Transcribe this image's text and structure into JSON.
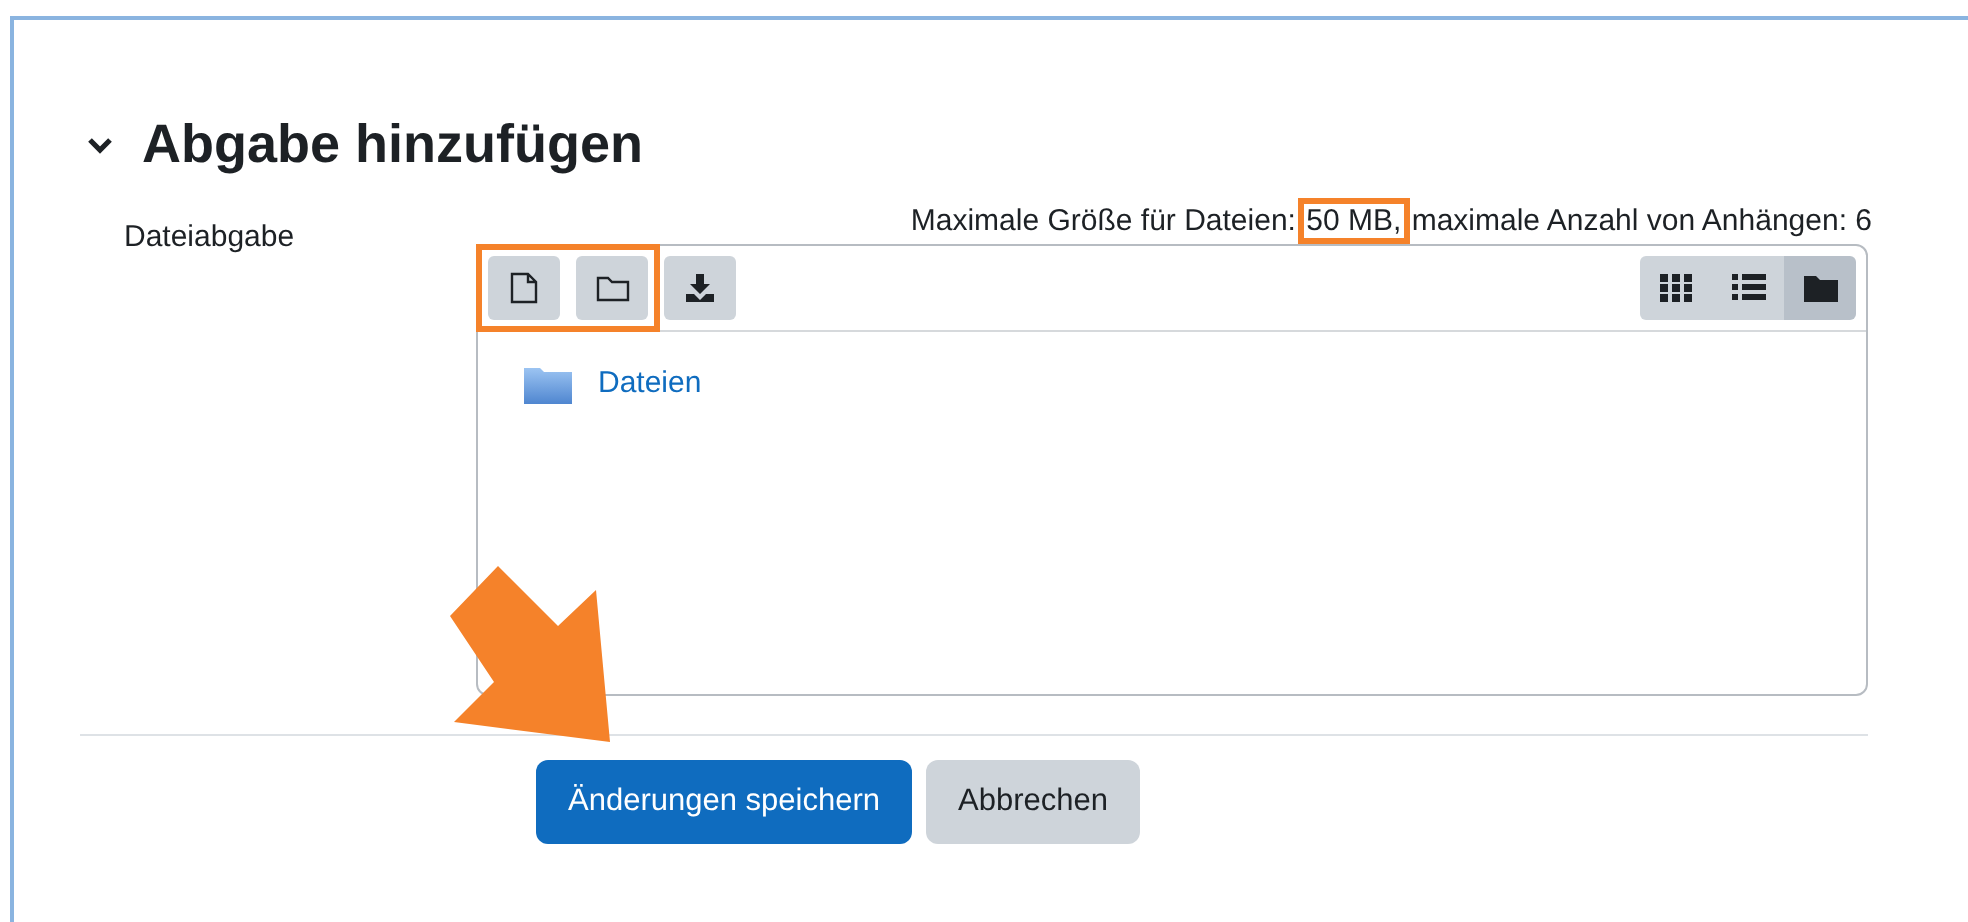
{
  "section": {
    "title": "Abgabe hinzufügen",
    "expanded": true
  },
  "field": {
    "label": "Dateiabgabe",
    "limits": {
      "before": "Maximale Größe für Dateien: ",
      "highlight": "50 MB,",
      "after": " maximale Anzahl von Anhängen: 6"
    }
  },
  "toolbar_groups": [
    {
      "highlighted": true,
      "buttons": [
        {
          "kind": "file"
        },
        {
          "kind": "folder"
        }
      ]
    },
    {
      "buttons": [
        {
          "kind": "download"
        }
      ]
    }
  ],
  "views": [
    {
      "kind": "icons",
      "selected": false
    },
    {
      "kind": "list",
      "selected": false
    },
    {
      "kind": "tree",
      "selected": true
    }
  ],
  "files": [
    {
      "name": "Dateien"
    }
  ],
  "buttons": [
    {
      "label": "Änderungen speichern",
      "kind": "primary"
    },
    {
      "label": "Abbrechen",
      "kind": "secondary"
    }
  ],
  "annotation_arrow": true
}
